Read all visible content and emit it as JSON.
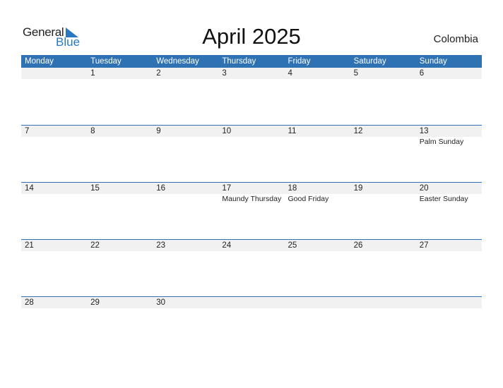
{
  "logo": {
    "general": "General",
    "blue": "Blue"
  },
  "title": "April 2025",
  "country": "Colombia",
  "weekdays": [
    "Monday",
    "Tuesday",
    "Wednesday",
    "Thursday",
    "Friday",
    "Saturday",
    "Sunday"
  ],
  "weeks": [
    {
      "days": [
        "",
        "1",
        "2",
        "3",
        "4",
        "5",
        "6"
      ],
      "events": [
        "",
        "",
        "",
        "",
        "",
        "",
        ""
      ]
    },
    {
      "days": [
        "7",
        "8",
        "9",
        "10",
        "11",
        "12",
        "13"
      ],
      "events": [
        "",
        "",
        "",
        "",
        "",
        "",
        "Palm Sunday"
      ]
    },
    {
      "days": [
        "14",
        "15",
        "16",
        "17",
        "18",
        "19",
        "20"
      ],
      "events": [
        "",
        "",
        "",
        "Maundy Thursday",
        "Good Friday",
        "",
        "Easter Sunday"
      ]
    },
    {
      "days": [
        "21",
        "22",
        "23",
        "24",
        "25",
        "26",
        "27"
      ],
      "events": [
        "",
        "",
        "",
        "",
        "",
        "",
        ""
      ]
    },
    {
      "days": [
        "28",
        "29",
        "30",
        "",
        "",
        "",
        ""
      ],
      "events": [
        "",
        "",
        "",
        "",
        "",
        "",
        ""
      ]
    }
  ],
  "colors": {
    "header_bg": "#2e72b3",
    "day_row_bg": "#f1f1f1",
    "brand_blue": "#2a78c2"
  }
}
